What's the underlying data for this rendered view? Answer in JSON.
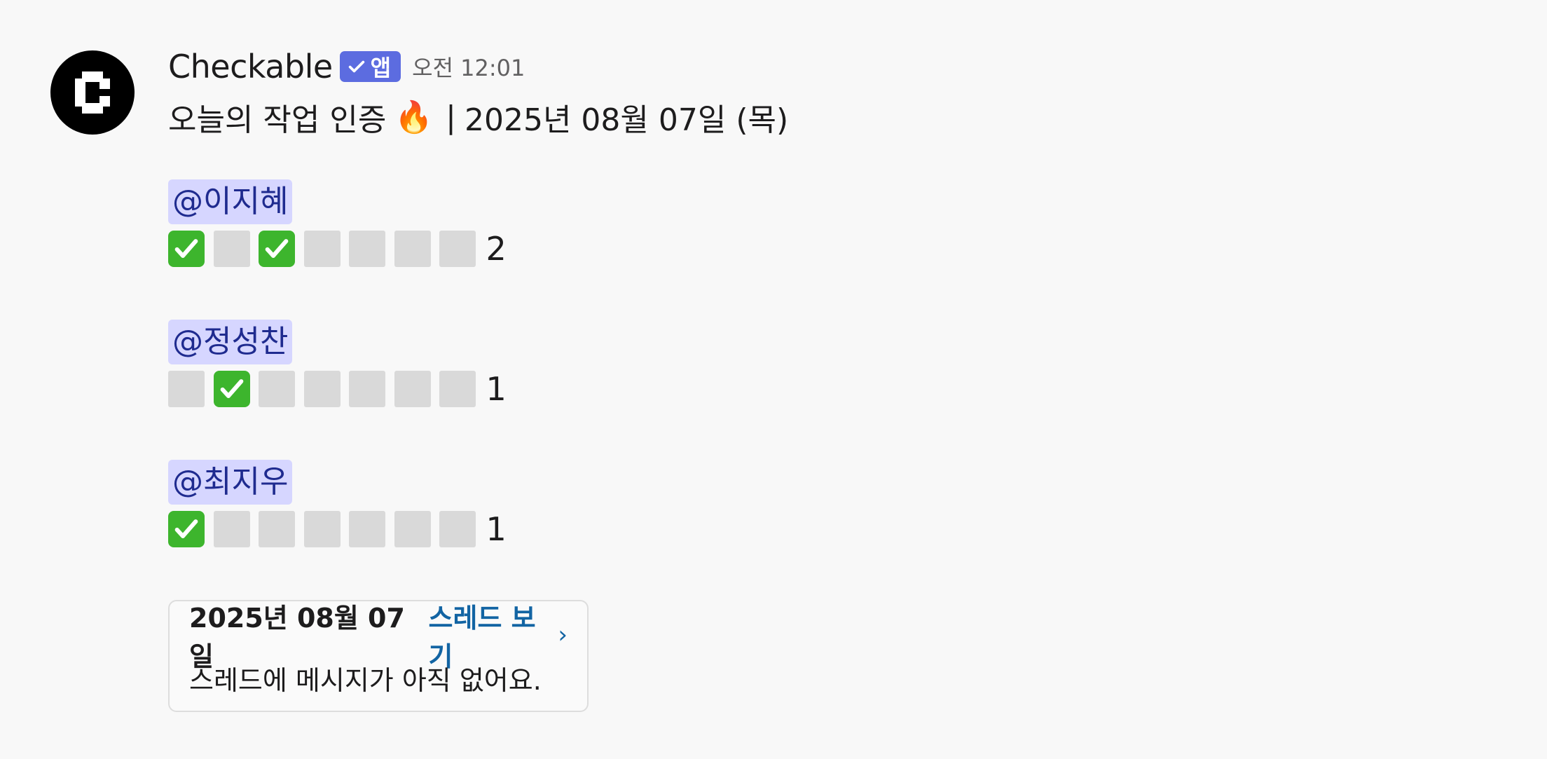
{
  "sender": {
    "name": "Checkable",
    "badge": "앱",
    "timestamp": "오전 12:01",
    "avatar_icon": "checkable-logo-icon"
  },
  "title": {
    "text": "오늘의 작업 인증",
    "emoji": "🔥",
    "separator": "|",
    "date": "2025년 08월 07일 (목)"
  },
  "users": [
    {
      "mention": "@이지혜",
      "days": [
        true,
        false,
        true,
        false,
        false,
        false,
        false
      ],
      "count": "2"
    },
    {
      "mention": "@정성찬",
      "days": [
        false,
        true,
        false,
        false,
        false,
        false,
        false
      ],
      "count": "1"
    },
    {
      "mention": "@최지우",
      "days": [
        true,
        false,
        false,
        false,
        false,
        false,
        false
      ],
      "count": "1"
    }
  ],
  "thread": {
    "date": "2025년 08월 07일",
    "link_label": "스레드 보기",
    "chevron": "›",
    "empty_message": "스레드에 메시지가 아직 없어요."
  },
  "colors": {
    "mention_bg": "#d6d6ff",
    "mention_text": "#1f2b8f",
    "badge_bg": "#5c6ce0",
    "check_green": "#3db52d",
    "link_blue": "#1264a3"
  }
}
